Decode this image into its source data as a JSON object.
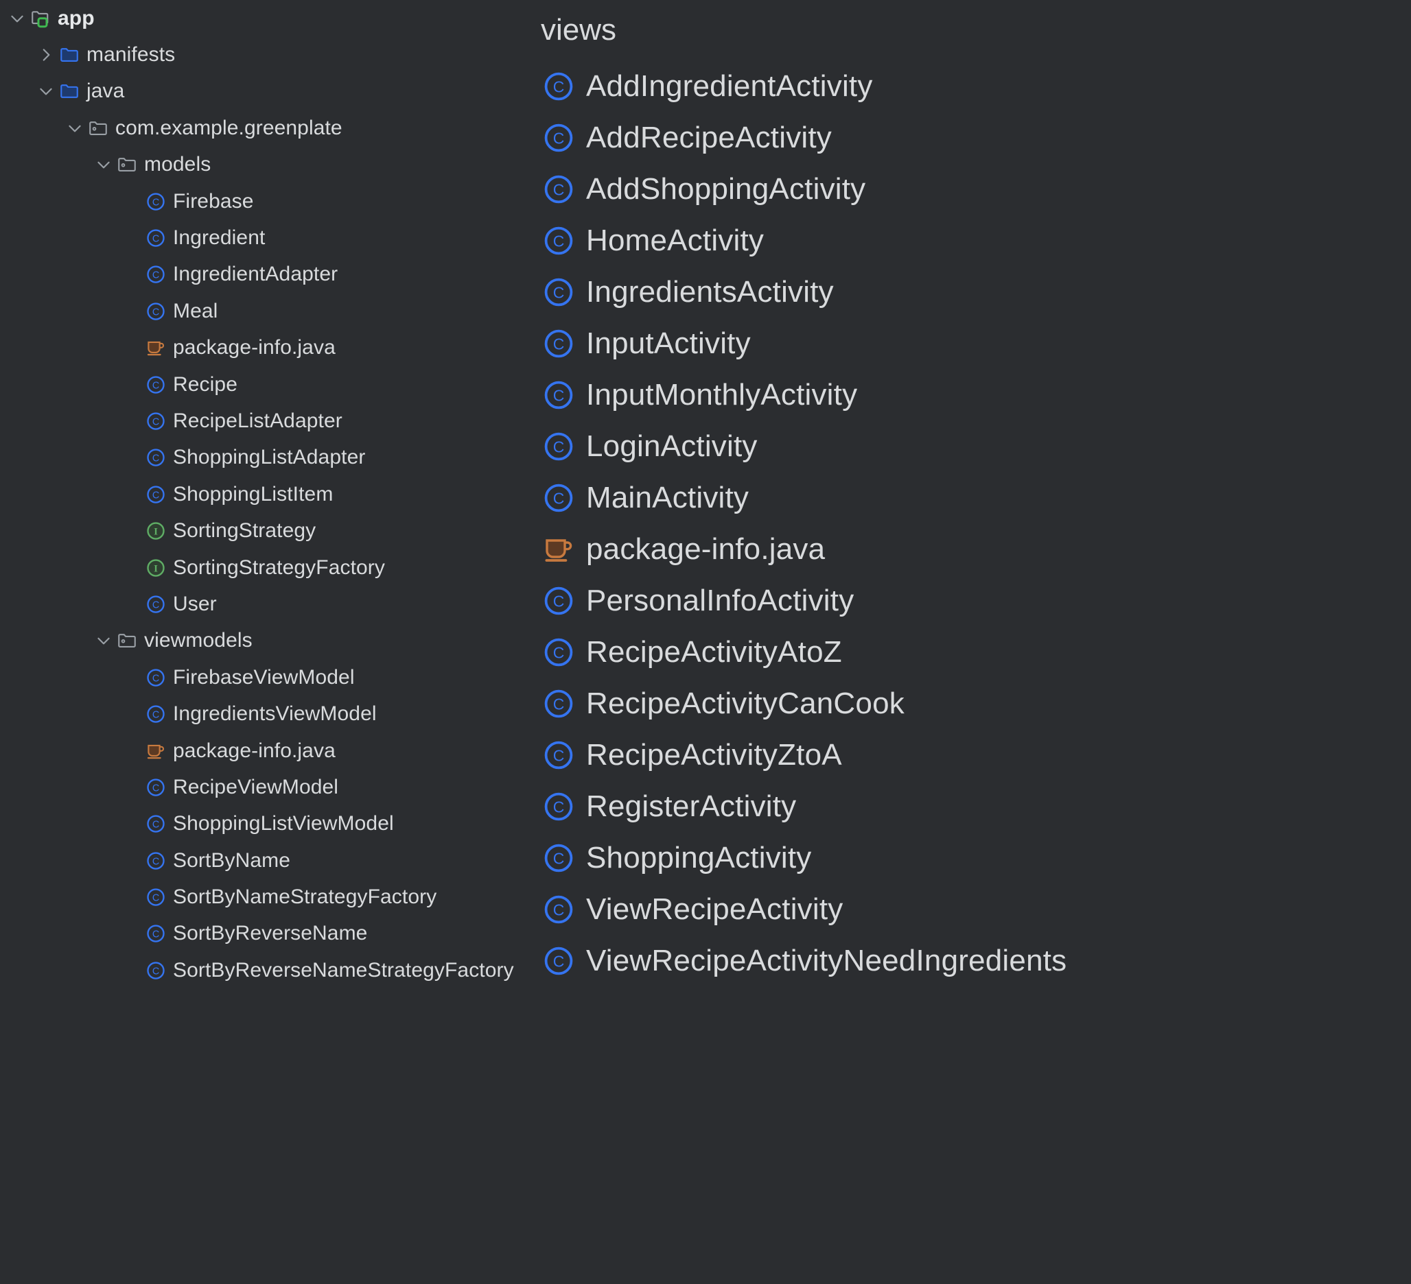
{
  "theme": {
    "background": "#2b2d30",
    "text": "#d9dbdd",
    "class_icon": "#3574F0",
    "interface_icon": "#5FAD65",
    "java_file_icon": "#C87A3F",
    "folder_blue": "#3574F0",
    "folder_gray": "#9aa0a6",
    "module_badge_green": "#3FB950",
    "chevron": "#9aa0a6"
  },
  "project_tree": {
    "name": "project-tree",
    "items": [
      {
        "label": "app",
        "indent": 0,
        "chevron": "down",
        "icon": "module-folder-icon"
      },
      {
        "label": "manifests",
        "indent": 1,
        "chevron": "right",
        "icon": "folder-blue-icon"
      },
      {
        "label": "java",
        "indent": 1,
        "chevron": "down",
        "icon": "folder-blue-icon"
      },
      {
        "label": "com.example.greenplate",
        "indent": 2,
        "chevron": "down",
        "icon": "package-folder-icon"
      },
      {
        "label": "models",
        "indent": 3,
        "chevron": "down",
        "icon": "package-folder-icon"
      },
      {
        "label": "Firebase",
        "indent": 4,
        "chevron": "none",
        "icon": "class-icon"
      },
      {
        "label": "Ingredient",
        "indent": 4,
        "chevron": "none",
        "icon": "class-icon"
      },
      {
        "label": "IngredientAdapter",
        "indent": 4,
        "chevron": "none",
        "icon": "class-icon"
      },
      {
        "label": "Meal",
        "indent": 4,
        "chevron": "none",
        "icon": "class-icon"
      },
      {
        "label": "package-info.java",
        "indent": 4,
        "chevron": "none",
        "icon": "java-file-icon"
      },
      {
        "label": "Recipe",
        "indent": 4,
        "chevron": "none",
        "icon": "class-icon"
      },
      {
        "label": "RecipeListAdapter",
        "indent": 4,
        "chevron": "none",
        "icon": "class-icon"
      },
      {
        "label": "ShoppingListAdapter",
        "indent": 4,
        "chevron": "none",
        "icon": "class-icon"
      },
      {
        "label": "ShoppingListItem",
        "indent": 4,
        "chevron": "none",
        "icon": "class-icon"
      },
      {
        "label": "SortingStrategy",
        "indent": 4,
        "chevron": "none",
        "icon": "interface-icon"
      },
      {
        "label": "SortingStrategyFactory",
        "indent": 4,
        "chevron": "none",
        "icon": "interface-icon"
      },
      {
        "label": "User",
        "indent": 4,
        "chevron": "none",
        "icon": "class-icon"
      },
      {
        "label": "viewmodels",
        "indent": 3,
        "chevron": "down",
        "icon": "package-folder-icon"
      },
      {
        "label": "FirebaseViewModel",
        "indent": 4,
        "chevron": "none",
        "icon": "class-icon"
      },
      {
        "label": "IngredientsViewModel",
        "indent": 4,
        "chevron": "none",
        "icon": "class-icon"
      },
      {
        "label": "package-info.java",
        "indent": 4,
        "chevron": "none",
        "icon": "java-file-icon"
      },
      {
        "label": "RecipeViewModel",
        "indent": 4,
        "chevron": "none",
        "icon": "class-icon"
      },
      {
        "label": "ShoppingListViewModel",
        "indent": 4,
        "chevron": "none",
        "icon": "class-icon"
      },
      {
        "label": "SortByName",
        "indent": 4,
        "chevron": "none",
        "icon": "class-icon"
      },
      {
        "label": "SortByNameStrategyFactory",
        "indent": 4,
        "chevron": "none",
        "icon": "class-icon"
      },
      {
        "label": "SortByReverseName",
        "indent": 4,
        "chevron": "none",
        "icon": "class-icon"
      },
      {
        "label": "SortByReverseNameStrategyFactory",
        "indent": 4,
        "chevron": "none",
        "icon": "class-icon"
      }
    ]
  },
  "views_list": {
    "name": "views-package-list",
    "header": "views",
    "items": [
      {
        "label": "AddIngredientActivity",
        "icon": "class-icon"
      },
      {
        "label": "AddRecipeActivity",
        "icon": "class-icon"
      },
      {
        "label": "AddShoppingActivity",
        "icon": "class-icon"
      },
      {
        "label": "HomeActivity",
        "icon": "class-icon"
      },
      {
        "label": "IngredientsActivity",
        "icon": "class-icon"
      },
      {
        "label": "InputActivity",
        "icon": "class-icon"
      },
      {
        "label": "InputMonthlyActivity",
        "icon": "class-icon"
      },
      {
        "label": "LoginActivity",
        "icon": "class-icon"
      },
      {
        "label": "MainActivity",
        "icon": "class-icon"
      },
      {
        "label": "package-info.java",
        "icon": "java-file-icon"
      },
      {
        "label": "PersonalInfoActivity",
        "icon": "class-icon"
      },
      {
        "label": "RecipeActivityAtoZ",
        "icon": "class-icon"
      },
      {
        "label": "RecipeActivityCanCook",
        "icon": "class-icon"
      },
      {
        "label": "RecipeActivityZtoA",
        "icon": "class-icon"
      },
      {
        "label": "RegisterActivity",
        "icon": "class-icon"
      },
      {
        "label": "ShoppingActivity",
        "icon": "class-icon"
      },
      {
        "label": "ViewRecipeActivity",
        "icon": "class-icon"
      },
      {
        "label": "ViewRecipeActivityNeedIngredients",
        "icon": "class-icon"
      }
    ]
  }
}
